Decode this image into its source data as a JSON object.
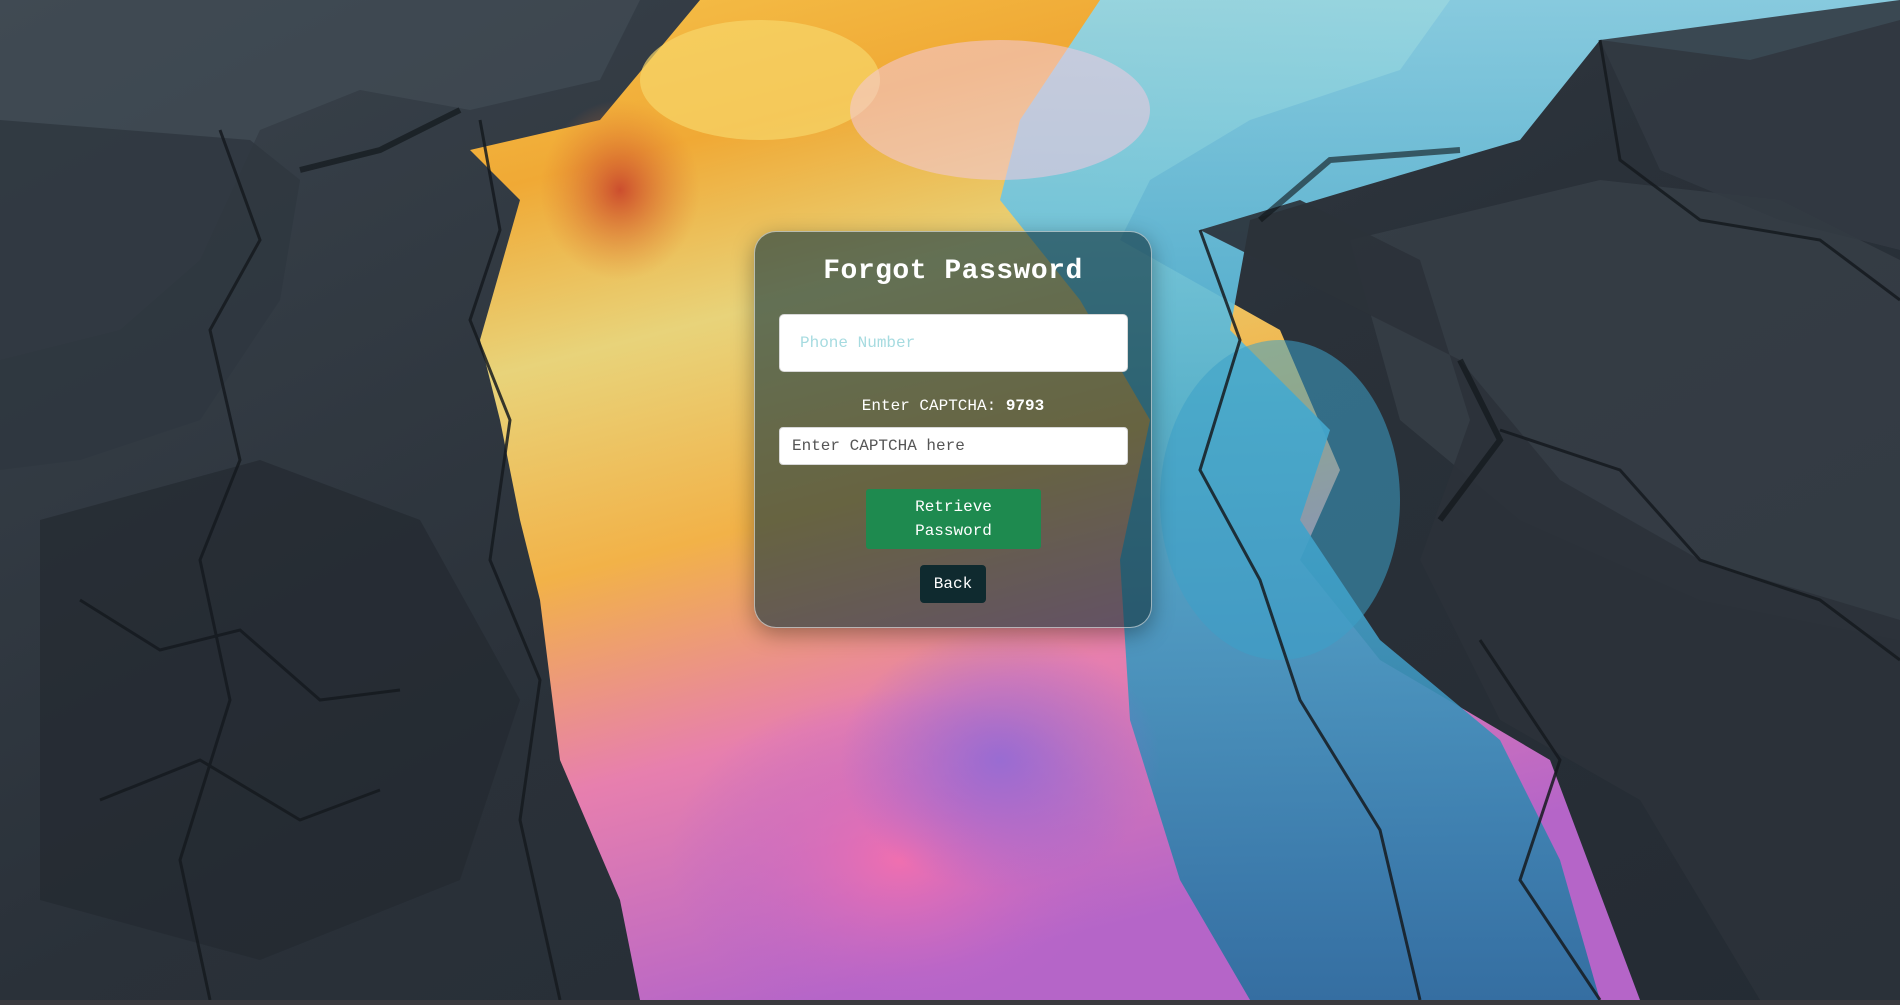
{
  "forgot_form": {
    "title": "Forgot Password",
    "phone_placeholder": "Phone Number",
    "captcha_prompt": "Enter CAPTCHA:",
    "captcha_code": "9793",
    "captcha_placeholder": "Enter CAPTCHA here",
    "retrieve_label": "Retrieve Password",
    "back_label": "Back"
  },
  "colors": {
    "card_background": "#12343e",
    "retrieve_button": "#1e8a4f",
    "back_button": "#0f2a2f",
    "asphalt": "#2b333c",
    "oil_sheen_yellow": "#f2b531",
    "oil_sheen_blue": "#3fa9cf",
    "oil_sheen_pink": "#d76aa8"
  }
}
